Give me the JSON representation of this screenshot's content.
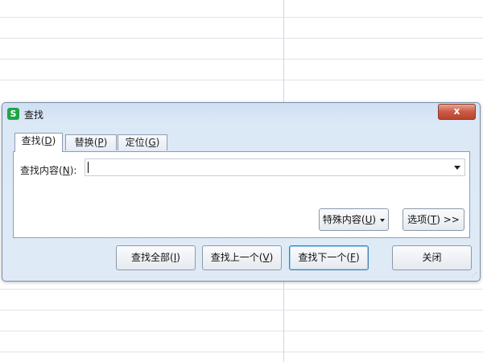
{
  "dialog": {
    "title": "查找",
    "app_icon_letter": "S",
    "close_label": "x",
    "tabs": [
      {
        "label": "查找",
        "accel": "D"
      },
      {
        "label": "替换",
        "accel": "P"
      },
      {
        "label": "定位",
        "accel": "G"
      }
    ],
    "find": {
      "label": "查找内容",
      "accel": "N",
      "value": "",
      "placeholder": ""
    },
    "special_button": {
      "label": "特殊内容",
      "accel": "U"
    },
    "options_button": {
      "label": "选项",
      "accel": "T",
      "suffix": ">>"
    },
    "bottom_buttons": [
      {
        "label": "查找全部",
        "accel": "I"
      },
      {
        "label": "查找上一个",
        "accel": "V"
      },
      {
        "label": "查找下一个",
        "accel": "F"
      },
      {
        "label": "关闭"
      }
    ]
  },
  "colors": {
    "app_icon": "#1fa546",
    "close_button": "#c95a44",
    "focus_border": "#3c7fb1",
    "grid_line": "#dfe3ea"
  }
}
